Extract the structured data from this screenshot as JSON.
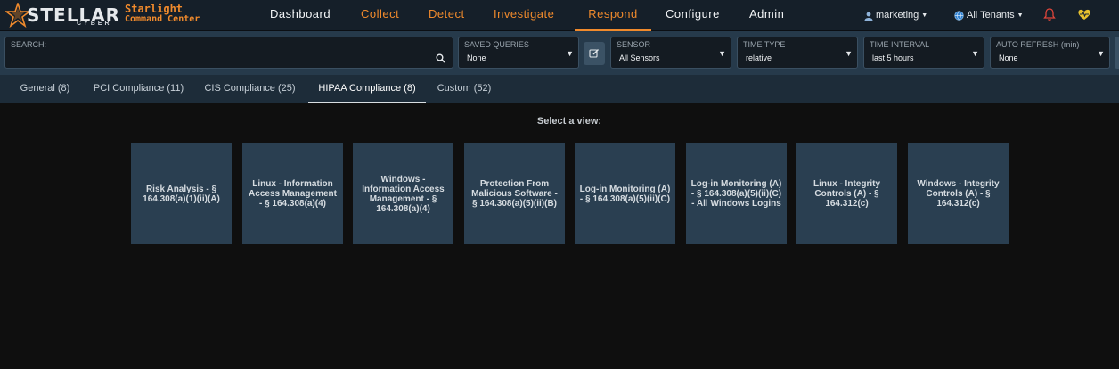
{
  "brand": {
    "name": "STELLAR",
    "sub": "CYBER",
    "product_line1": "Starlight",
    "product_line2": "Command Center"
  },
  "nav": {
    "items": [
      {
        "label": "Dashboard",
        "color": "white"
      },
      {
        "label": "Collect",
        "color": "orange"
      },
      {
        "label": "Detect",
        "color": "orange"
      },
      {
        "label": "Investigate",
        "color": "orange"
      },
      {
        "label": "Respond",
        "color": "orange",
        "active": true
      },
      {
        "label": "Configure",
        "color": "white"
      },
      {
        "label": "Admin",
        "color": "white"
      }
    ],
    "user": "marketing",
    "tenant": "All Tenants"
  },
  "filters": {
    "search_label": "SEARCH:",
    "search_value": "",
    "saved_queries": {
      "label": "SAVED QUERIES",
      "value": "None"
    },
    "sensor": {
      "label": "SENSOR",
      "value": "All Sensors"
    },
    "time_type": {
      "label": "TIME TYPE",
      "value": "relative"
    },
    "time_interval": {
      "label": "TIME INTERVAL",
      "value": "last 5 hours"
    },
    "auto_refresh": {
      "label": "AUTO REFRESH (min)",
      "value": "None"
    }
  },
  "tabs": [
    {
      "label": "General (8)"
    },
    {
      "label": "PCI Compliance (11)"
    },
    {
      "label": "CIS Compliance (25)"
    },
    {
      "label": "HIPAA Compliance (8)",
      "active": true
    },
    {
      "label": "Custom (52)"
    }
  ],
  "main": {
    "prompt": "Select a view:",
    "cards": [
      {
        "label": "Risk Analysis - § 164.308(a)(1)(ii)(A)"
      },
      {
        "label": "Linux - Information Access Management - § 164.308(a)(4)"
      },
      {
        "label": "Windows - Information Access Management - § 164.308(a)(4)"
      },
      {
        "label": "Protection From Malicious Software - § 164.308(a)(5)(ii)(B)"
      },
      {
        "label": "Log-in Monitoring (A) - § 164.308(a)(5)(ii)(C)"
      },
      {
        "label": "Log-in Monitoring (A) - § 164.308(a)(5)(ii)(C) - All Windows Logins"
      },
      {
        "label": "Linux - Integrity Controls (A) - § 164.312(c)"
      },
      {
        "label": "Windows - Integrity Controls (A) - § 164.312(c)"
      }
    ]
  },
  "colors": {
    "accent": "#f08a2c",
    "nav_bg": "#151f29",
    "filter_bg": "#263a4b",
    "tab_bg": "#1d2c39",
    "card_bg": "#2a3f51",
    "page_bg": "#0f0f0f"
  }
}
